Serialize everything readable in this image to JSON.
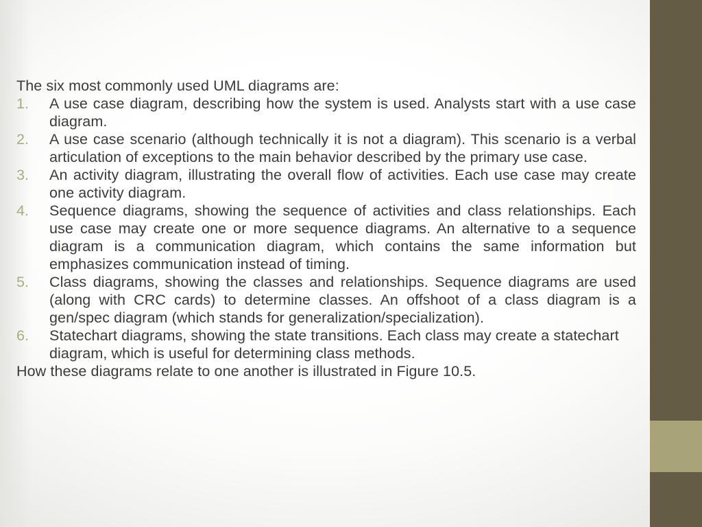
{
  "slide": {
    "intro": "The six most commonly used UML diagrams are:",
    "outro": "How these diagrams relate to one another is illustrated in Figure 10.5.",
    "items": [
      {
        "marker": "1.",
        "text": "A use case diagram, describing how the system is used. Analysts start with a use case diagram."
      },
      {
        "marker": "2.",
        "text": "A use case scenario (although technically it is not a diagram). This scenario is a verbal articulation of exceptions to the main behavior described by the primary use case."
      },
      {
        "marker": "3.",
        "text": "An activity diagram, illustrating the overall flow of activities. Each use case may create one activity diagram."
      },
      {
        "marker": "4.",
        "text": "Sequence diagrams, showing the sequence of activities and class relationships. Each use case may create one or more sequence diagrams. An alternative to a sequence diagram is a communication diagram, which contains the same information but emphasizes communication instead of timing."
      },
      {
        "marker": "5.",
        "text": "Class diagrams, showing the classes and relationships. Sequence diagrams are used (along with CRC cards) to determine classes. An offshoot of a class diagram is a gen/spec diagram (which stands for generalization/specialization)."
      },
      {
        "marker": "6.",
        "text": "Statechart diagrams, showing the state transitions. Each class may create a statechart diagram, which is useful for determining class methods."
      }
    ]
  },
  "theme": {
    "text_color": "#3a3a38",
    "marker_color": "#a8ac81",
    "bar_dark": "#655c45",
    "bar_light": "#a8a478",
    "background": "#ffffff"
  }
}
